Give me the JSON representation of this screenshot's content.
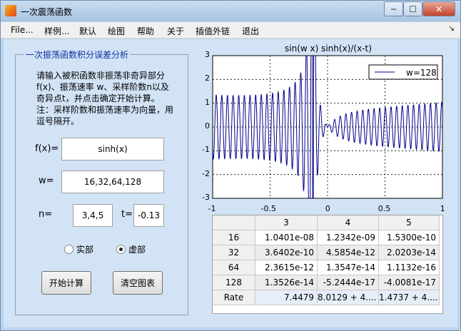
{
  "window": {
    "title": "一次震荡函数"
  },
  "menu": [
    "File...",
    "样例...",
    "默认",
    "绘图",
    "帮助",
    "关于",
    "插值外链",
    "退出"
  ],
  "panel": {
    "title": "一次振荡函数积分误差分析",
    "instructions": "请输入被积函数非振荡非奇异部分 f(x)、振荡速率 w、采样阶数n以及奇异点t，并点击确定开始计算。 注：采样阶数和振荡速率为向量，用逗号隔开。",
    "fx_label": "f(x)=",
    "fx_value": "sinh(x)",
    "w_label": "w=",
    "w_value": "16,32,64,128",
    "n_label": "n=",
    "n_value": "3,4,5",
    "t_label": "t=",
    "t_value": "-0.13",
    "radio_real": "实部",
    "radio_imag": "虚部",
    "start_button": "开始计算",
    "clear_button": "清空图表"
  },
  "plot": {
    "title": "sin(w x) sinh(x)/(x-t)",
    "legend": "w=128",
    "yticks": [
      "3",
      "2",
      "1",
      "0",
      "-1",
      "-2",
      "-3"
    ],
    "xticks": [
      "-1",
      "-0.5",
      "0",
      "0.5",
      "1"
    ]
  },
  "chart_data": {
    "type": "line",
    "title": "sin(w x) sinh(x)/(x-t)",
    "xlim": [
      -1,
      1
    ],
    "ylim": [
      -3,
      3
    ],
    "grid": true,
    "legend_placement": "top-right",
    "series": [
      {
        "name": "w=128",
        "function": "sin(128 x) sinh(x)/(x+0.13)",
        "color": "#00008b"
      }
    ]
  },
  "table": {
    "columns": [
      "",
      "3",
      "4",
      "5"
    ],
    "rows": [
      [
        "16",
        "1.0401e-08",
        "1.2342e-09",
        "1.5300e-10"
      ],
      [
        "32",
        "3.6402e-10",
        "4.5854e-12",
        "2.0203e-14"
      ],
      [
        "64",
        "2.3615e-12",
        "1.3547e-14",
        "1.1132e-16"
      ],
      [
        "128",
        "1.3526e-14",
        "-5.2444e-17",
        "-4.0081e-17"
      ],
      [
        "Rate",
        "7.4479",
        "8.0129 + 4....",
        "1.4737 + 4...."
      ]
    ]
  }
}
